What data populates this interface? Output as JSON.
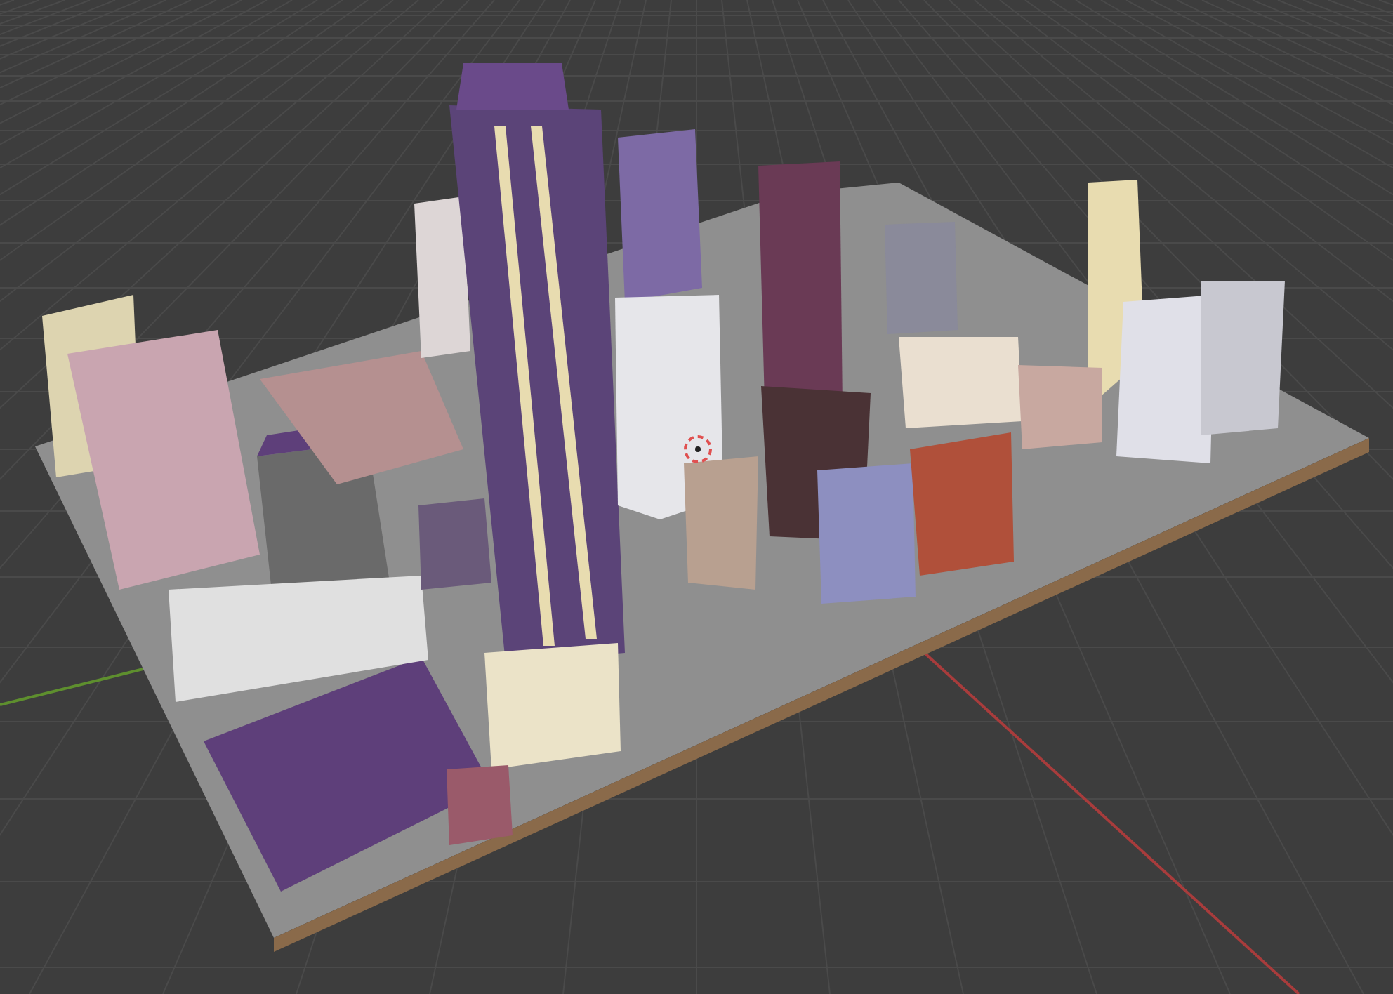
{
  "viewport": {
    "axes": [
      {
        "kind": "x",
        "color": "#a83c3c"
      },
      {
        "kind": "y",
        "color": "#5e8f2e"
      }
    ]
  }
}
